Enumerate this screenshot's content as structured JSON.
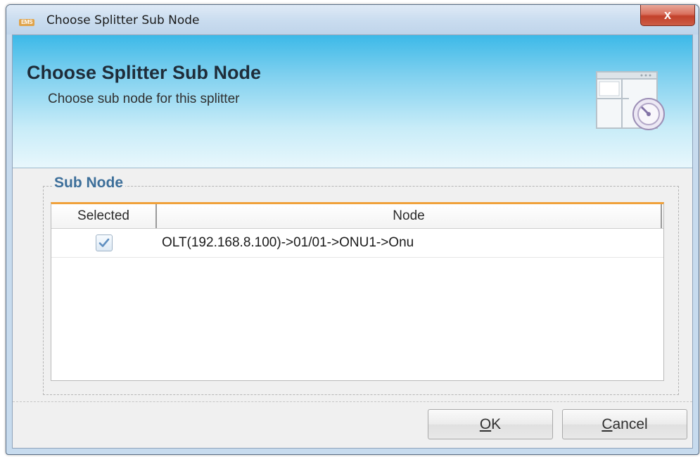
{
  "window": {
    "title": "Choose Splitter Sub Node",
    "app_icon_text": "EMS",
    "close_label": "x"
  },
  "banner": {
    "title": "Choose Splitter Sub Node",
    "subtitle": "Choose sub node for this splitter",
    "icon": "window-clock-icon"
  },
  "group": {
    "title": "Sub Node"
  },
  "table": {
    "columns": [
      "Selected",
      "Node"
    ],
    "rows": [
      {
        "selected": true,
        "node": "OLT(192.168.8.100)->01/01->ONU1->Onu"
      }
    ]
  },
  "buttons": {
    "ok_mnemonic": "O",
    "ok_rest": "K",
    "cancel_mnemonic": "C",
    "cancel_rest": "ancel"
  },
  "colors": {
    "banner_top": "#3cb9e8",
    "table_header_accent": "#f0a13a",
    "group_title": "#3d6f9a",
    "close_button": "#c2412b"
  }
}
